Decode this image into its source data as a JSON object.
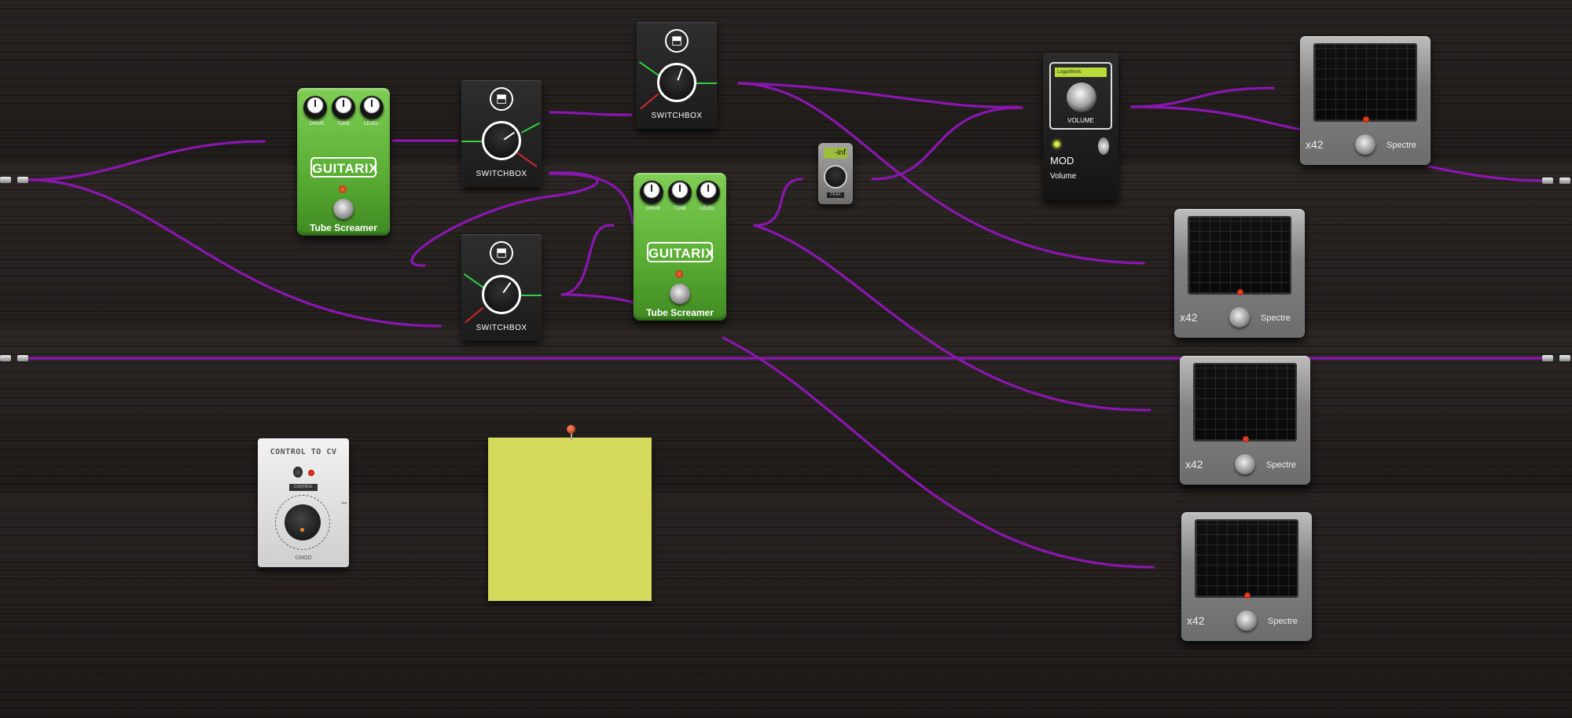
{
  "colors": {
    "cable": "#8a16b0",
    "pedal_green": "#5cb035",
    "note_yellow": "#d5d95c",
    "switch_line_green": "#32d040",
    "switch_line_red": "#d02828"
  },
  "tube_screamer_1": {
    "knob_labels": [
      "DRIVE",
      "TONE",
      "LEVEL"
    ],
    "brand": "GUITARIX",
    "name": "Tube Screamer"
  },
  "tube_screamer_2": {
    "knob_labels": [
      "DRIVE",
      "TONE",
      "LEVEL"
    ],
    "brand": "GUITARIX",
    "name": "Tube Screamer"
  },
  "switchbox_1": {
    "icon": "disk-icon",
    "name": "SWITCHBOX"
  },
  "switchbox_2": {
    "icon": "disk-icon",
    "name": "SWITCHBOX"
  },
  "switchbox_3": {
    "icon": "disk-icon",
    "name": "SWITCHBOX"
  },
  "peakmeter": {
    "display": "-inf",
    "label": "PEAK"
  },
  "volume": {
    "select_value": "Logarithmic",
    "knob_label": "VOLUME",
    "brand": "MOD",
    "name": "Volume"
  },
  "spectre_1": {
    "model": "x42",
    "name": "Spectre"
  },
  "spectre_2": {
    "model": "x42",
    "name": "Spectre"
  },
  "spectre_3": {
    "model": "x42",
    "name": "Spectre"
  },
  "spectre_4": {
    "model": "x42",
    "name": "Spectre"
  },
  "control_to_cv": {
    "title": "CONTROL TO CV",
    "label": "CONTROL",
    "brand": "©MOD"
  }
}
